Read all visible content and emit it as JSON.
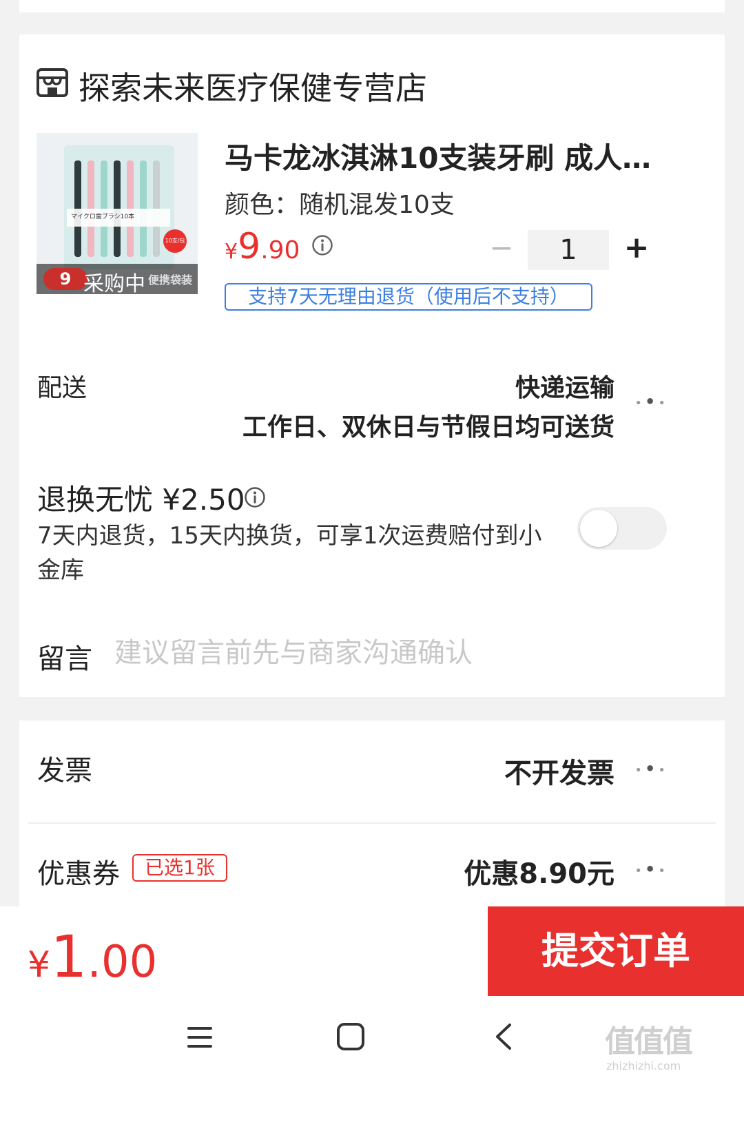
{
  "store": {
    "name": "探索未来医疗保健专营店",
    "icon": "store-icon"
  },
  "product": {
    "title": "马卡龙冰淇淋10支装牙刷 成人…",
    "spec": "颜色：随机混发10支",
    "price_symbol": "¥",
    "price_int": "9",
    "price_dec": ".90",
    "quantity": "1",
    "minus_label": "−",
    "plus_label": "+",
    "return_tag": "支持7天无理由退货（使用后不支持）",
    "image_overlay": "采购中",
    "image_price": "9",
    "image_side_text": "便携袋装",
    "image_badge": "10支/包",
    "image_caption": "マイクロ歯ブラシ10本"
  },
  "delivery": {
    "label": "配送",
    "method": "快递运输",
    "note": "工作日、双休日与节假日均可送货"
  },
  "return_service": {
    "title": "退换无忧 ¥2.50",
    "desc_line1": "7天内退货，15天内换货，可享1次运费赔付到小",
    "desc_line2": "金库",
    "toggle_on": false
  },
  "message": {
    "label": "留言",
    "placeholder": "建议留言前先与商家沟通确认"
  },
  "invoice": {
    "label": "发票",
    "value": "不开发票"
  },
  "coupon": {
    "label": "优惠券",
    "badge": "已选1张",
    "value": "优惠8.90元"
  },
  "footer": {
    "total_symbol": "¥",
    "total_int": "1",
    "total_dec": ".00",
    "submit_label": "提交订单"
  },
  "nav": {
    "menu_icon": "menu-icon",
    "home_icon": "home-icon",
    "back_icon": "back-icon"
  },
  "watermark": "值值值",
  "watermark_url": "zhizhizhi.com",
  "colors": {
    "accent": "#e8312f",
    "link_blue": "#3c7fe0",
    "placeholder": "#c8c8c8"
  }
}
